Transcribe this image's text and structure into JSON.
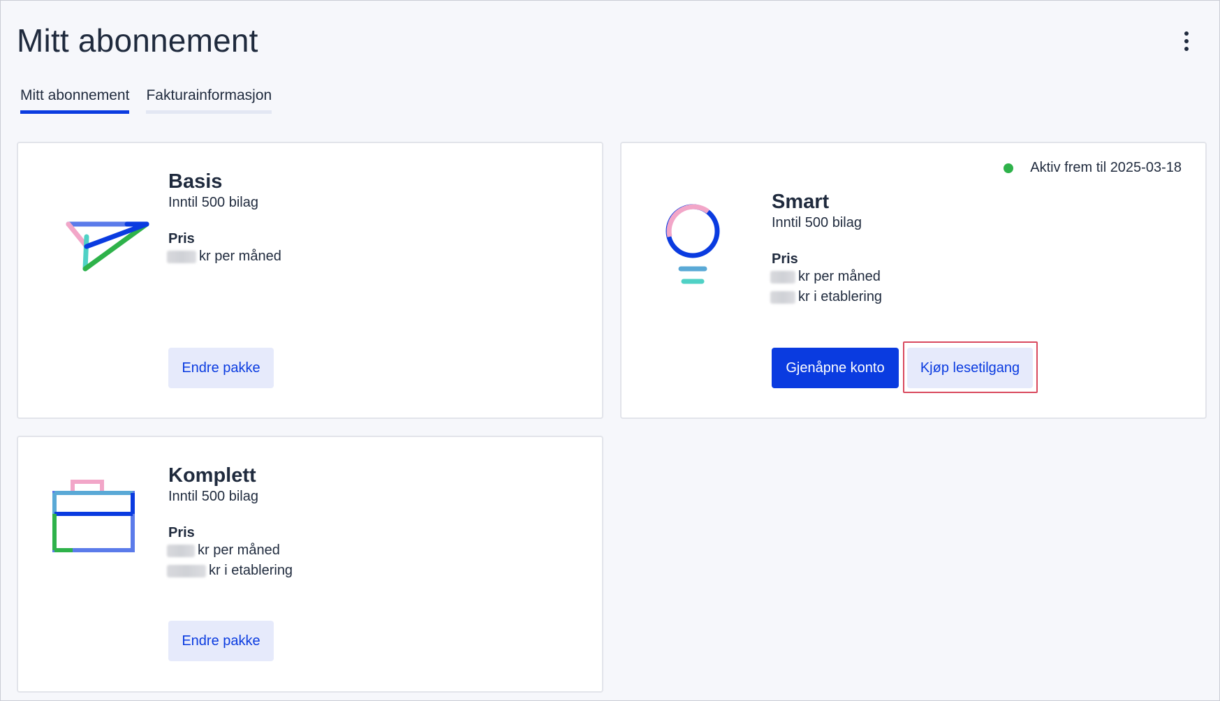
{
  "page": {
    "title": "Mitt abonnement",
    "more_menu_icon": "vertical-dots-icon"
  },
  "tabs": [
    {
      "label": "Mitt abonnement",
      "active": true
    },
    {
      "label": "Fakturainformasjon",
      "active": false
    }
  ],
  "plans": {
    "basis": {
      "name": "Basis",
      "subtitle": "Inntil 500 bilag",
      "price_label": "Pris",
      "monthly_suffix": "kr per måned",
      "button": "Endre pakke",
      "icon": "paper-plane-icon"
    },
    "smart": {
      "status_text": "Aktiv frem til 2025-03-18",
      "status_color": "#2eb24a",
      "name": "Smart",
      "subtitle": "Inntil 500 bilag",
      "price_label": "Pris",
      "monthly_suffix": "kr per måned",
      "setup_suffix": "kr i etablering",
      "primary_button": "Gjenåpne konto",
      "secondary_button": "Kjøp lesetilgang",
      "icon": "lightbulb-icon"
    },
    "komplett": {
      "name": "Komplett",
      "subtitle": "Inntil 500 bilag",
      "price_label": "Pris",
      "monthly_suffix": "kr per måned",
      "setup_suffix": "kr i etablering",
      "button": "Endre pakke",
      "icon": "briefcase-icon"
    }
  },
  "colors": {
    "accent": "#0a3be0",
    "secondary_button_bg": "#e6eafb",
    "highlight_border": "#d9495e",
    "icon_pink": "#f2a6c8",
    "icon_teal": "#4fd1c5",
    "icon_green": "#2eb24a",
    "icon_lightblue": "#5aa9d6"
  }
}
